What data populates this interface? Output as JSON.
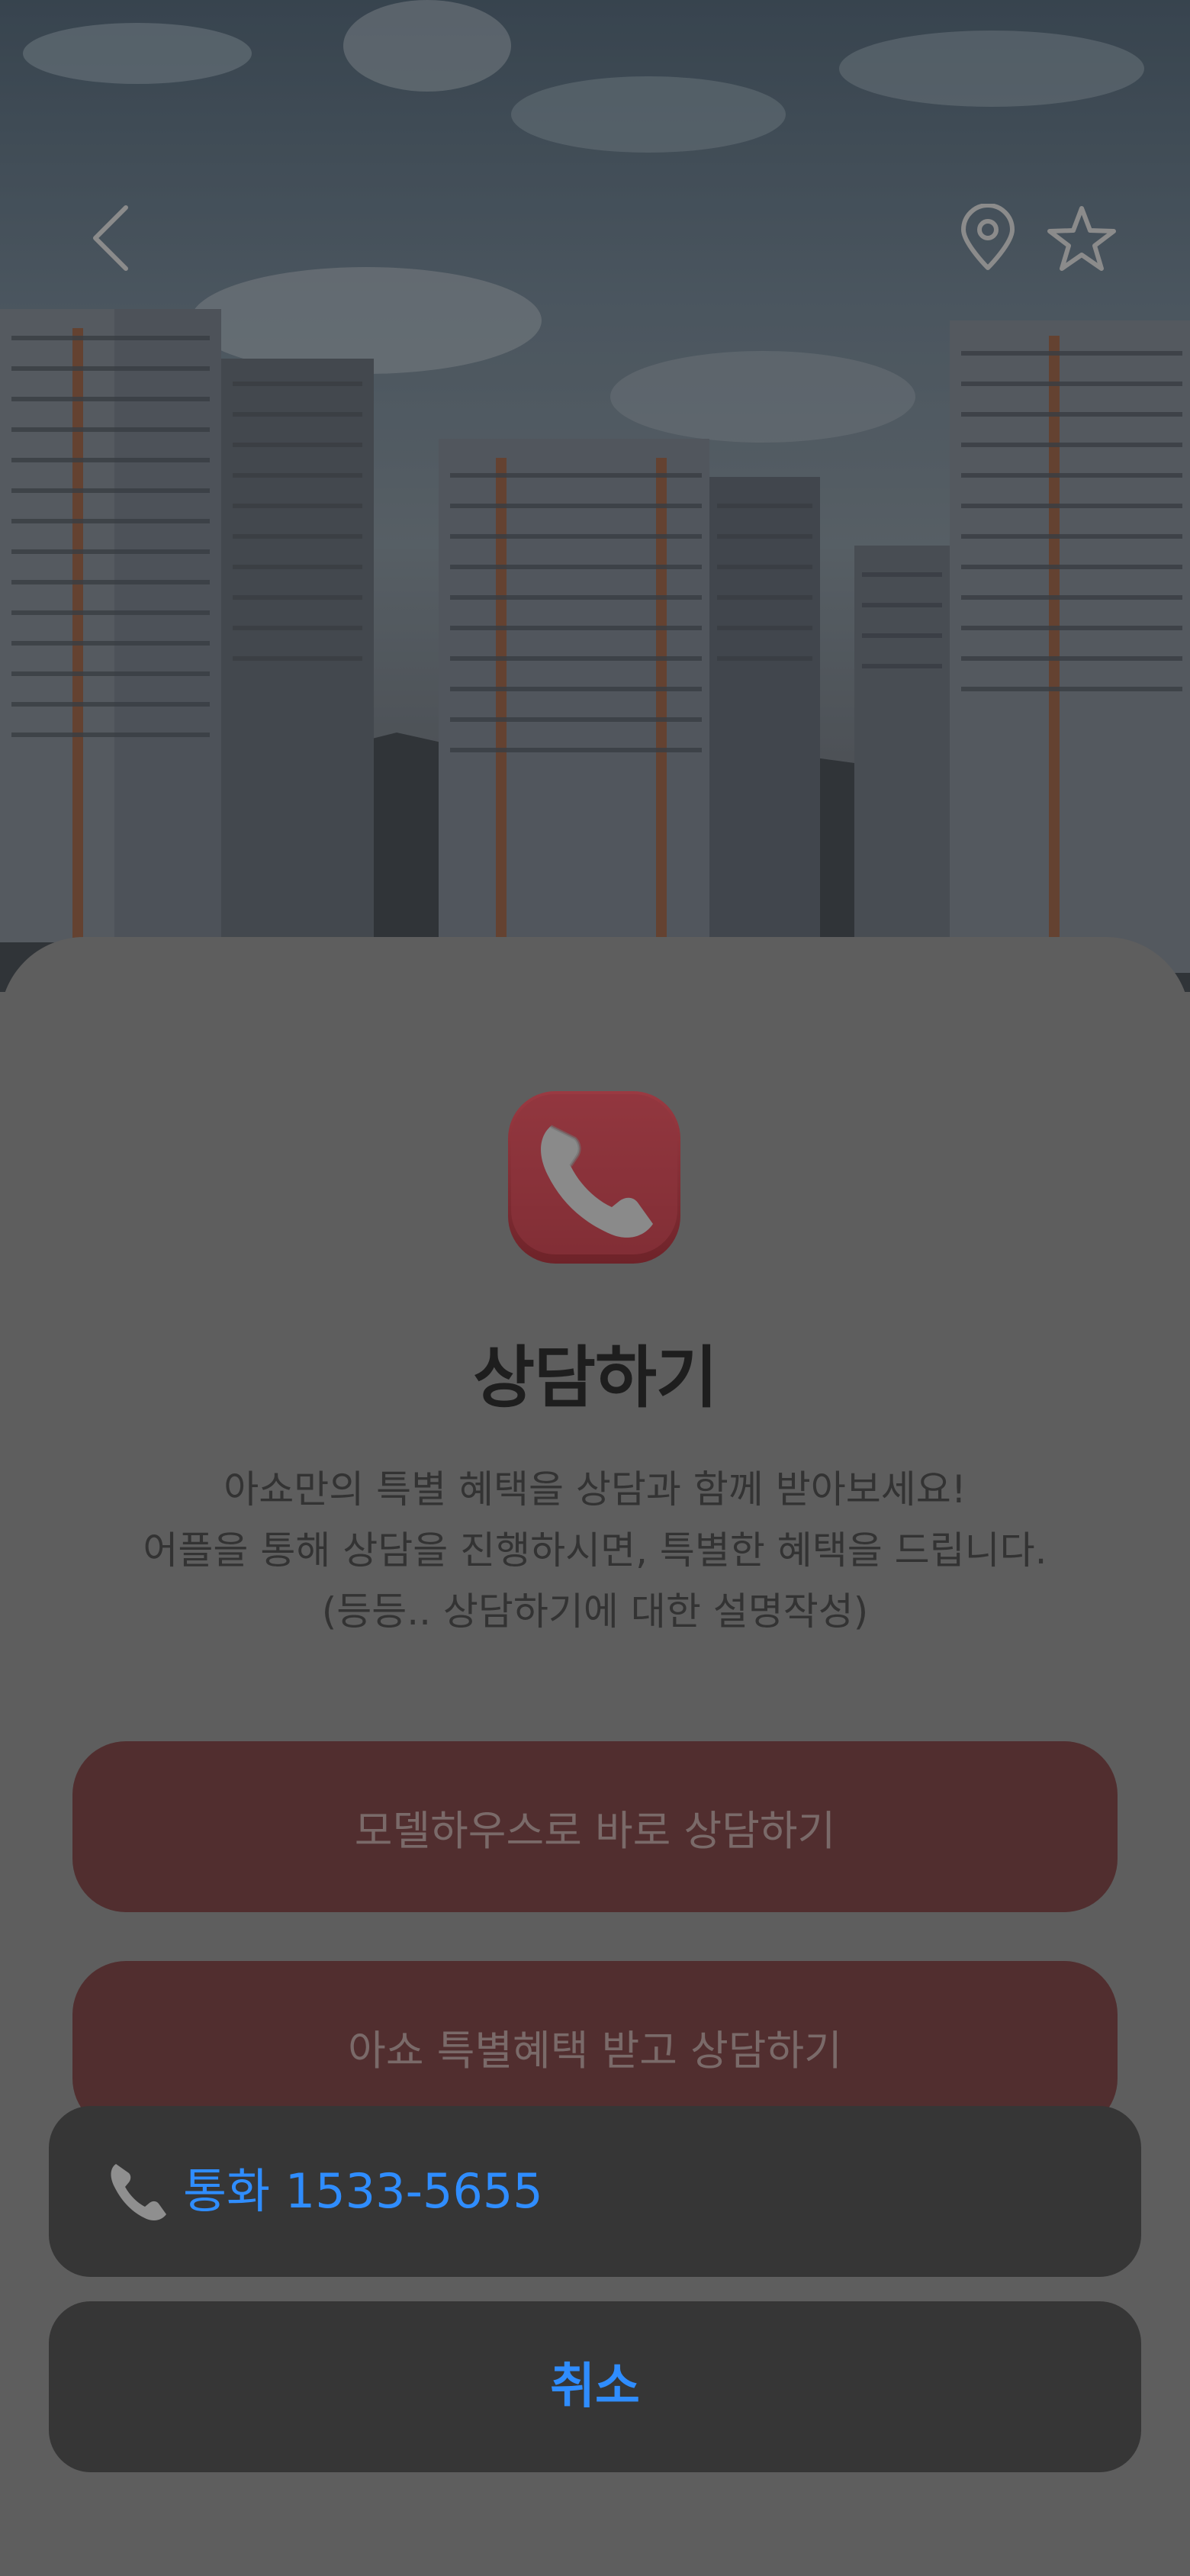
{
  "consult_sheet": {
    "title": "상담하기",
    "description_lines": [
      "아쇼만의 특별 혜택을 상담과 함께 받아보세요!",
      "어플을 통해 상담을 진행하시면, 특별한 혜택을 드립니다.",
      "(등등.. 상담하기에 대한 설명작성)"
    ],
    "buttons": [
      "모델하우스로 바로 상담하기",
      "아쇼 특별혜택 받고 상담하기"
    ],
    "icon": "phone-icon",
    "accent_color": "#c8404e"
  },
  "action_sheet": {
    "call_label": "통화 1533-5655",
    "call_icon": "phone-icon",
    "cancel_label": "취소",
    "action_color": "#2f8dff"
  },
  "top_bar": {
    "icons": [
      "back-chevron-icon",
      "location-pin-icon",
      "star-icon"
    ]
  }
}
